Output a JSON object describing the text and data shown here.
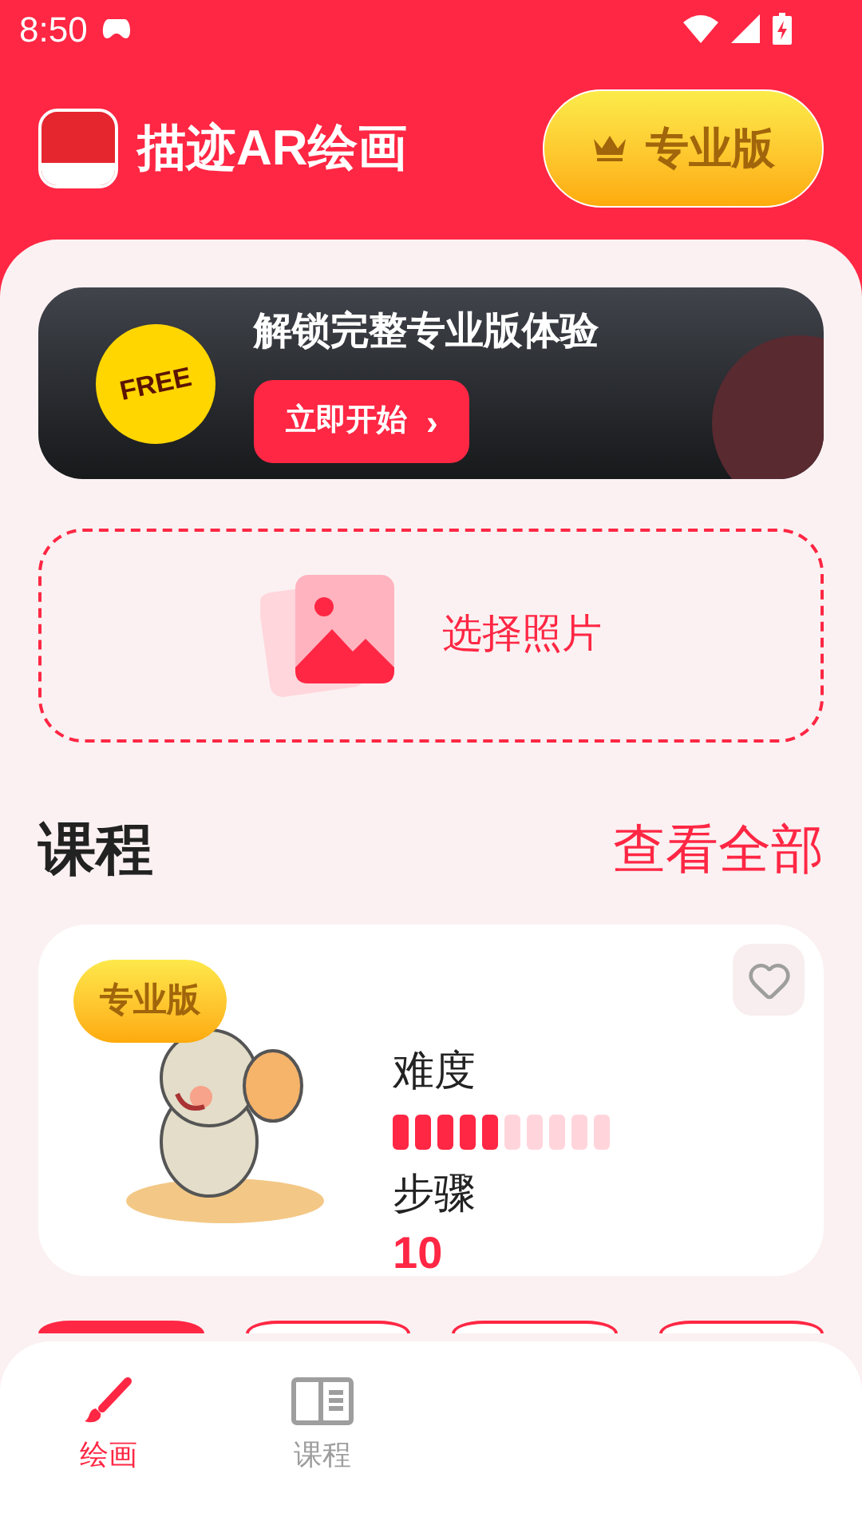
{
  "status_bar": {
    "time": "8:50"
  },
  "header": {
    "app_title": "描迹AR绘画",
    "pro_button": "专业版"
  },
  "promo_banner": {
    "badge": "FREE",
    "title": "解锁完整专业版体验",
    "button": "立即开始",
    "button_arrow": "›"
  },
  "photo_picker": {
    "label": "选择照片"
  },
  "courses": {
    "title": "课程",
    "view_all": "查看全部",
    "cards": [
      {
        "badge": "专业版",
        "favorite": false,
        "difficulty_label": "难度",
        "difficulty": {
          "level": 0.5
        },
        "steps_label": "步骤",
        "steps": "10"
      }
    ]
  },
  "category_chips": [
    {
      "selected": true
    },
    {
      "selected": false
    },
    {
      "selected": false
    },
    {
      "selected": false
    }
  ],
  "bottom_nav": [
    {
      "label": "绘画",
      "kind": "brush",
      "selected": true
    },
    {
      "label": "课程",
      "kind": "book",
      "selected": false
    }
  ]
}
